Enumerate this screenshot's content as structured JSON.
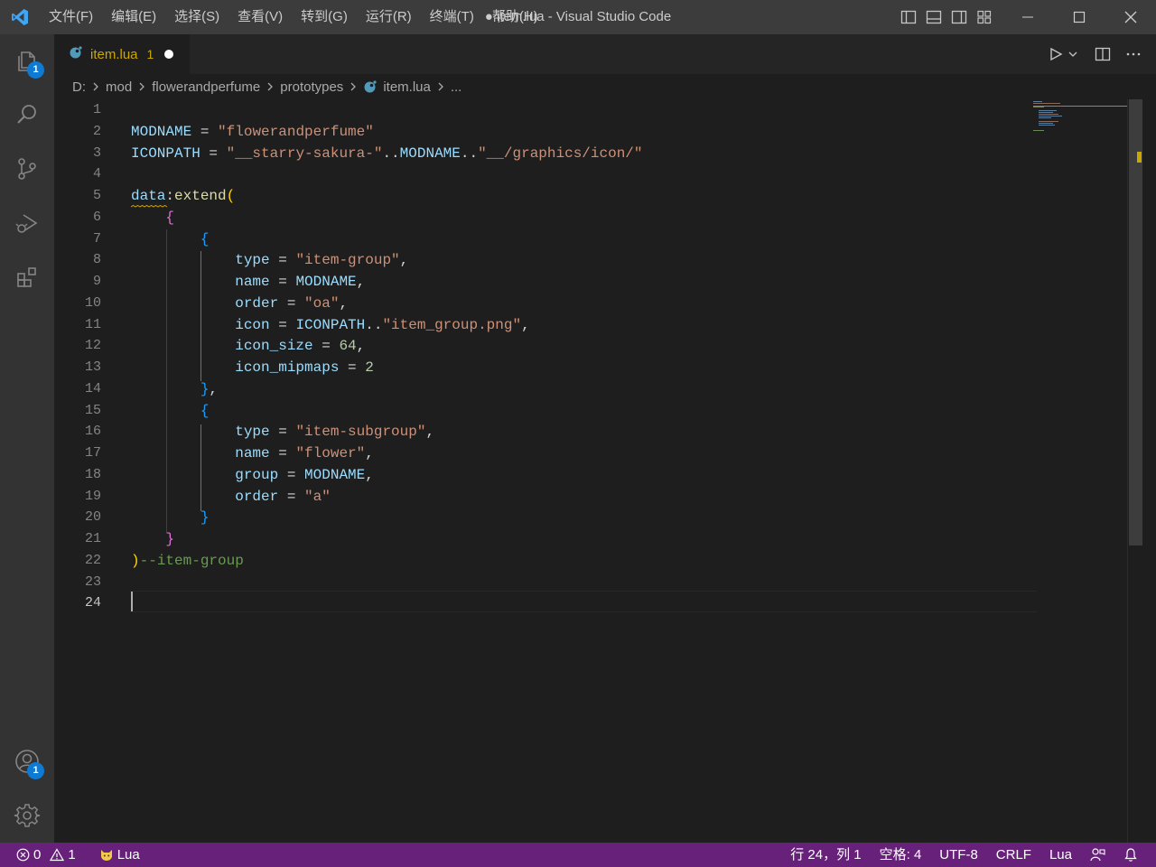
{
  "window": {
    "title": "● item.lua - Visual Studio Code",
    "menu": [
      "文件(F)",
      "编辑(E)",
      "选择(S)",
      "查看(V)",
      "转到(G)",
      "运行(R)",
      "终端(T)",
      "帮助(H)"
    ]
  },
  "activity_bar": {
    "explorer_badge": "1",
    "accounts_badge": "1"
  },
  "tab": {
    "name": "item.lua",
    "problem_count": "1"
  },
  "breadcrumb": [
    "D:",
    "mod",
    "flowerandperfume",
    "prototypes",
    "item.lua",
    "..."
  ],
  "editor": {
    "line_numbers": [
      "1",
      "2",
      "3",
      "4",
      "5",
      "6",
      "7",
      "8",
      "9",
      "10",
      "11",
      "12",
      "13",
      "14",
      "15",
      "16",
      "17",
      "18",
      "19",
      "20",
      "21",
      "22",
      "23",
      "24"
    ],
    "active_line": "24",
    "lines": [
      [],
      [
        {
          "t": "MODNAME",
          "c": "v-var"
        },
        {
          "t": " = ",
          "c": "v-op"
        },
        {
          "t": "\"flowerandperfume\"",
          "c": "v-str"
        }
      ],
      [
        {
          "t": "ICONPATH",
          "c": "v-var"
        },
        {
          "t": " = ",
          "c": "v-op"
        },
        {
          "t": "\"__starry-sakura-\"",
          "c": "v-str"
        },
        {
          "t": "..",
          "c": "v-op"
        },
        {
          "t": "MODNAME",
          "c": "v-var"
        },
        {
          "t": "..",
          "c": "v-op"
        },
        {
          "t": "\"__/graphics/icon/\"",
          "c": "v-str"
        }
      ],
      [],
      [
        {
          "t": "data",
          "c": "v-var"
        },
        {
          "t": ":",
          "c": "v-op"
        },
        {
          "t": "extend",
          "c": "v-fn"
        },
        {
          "t": "(",
          "c": "v-b1"
        }
      ],
      [
        {
          "t": "    ",
          "c": "v-op"
        },
        {
          "t": "{",
          "c": "v-b2"
        }
      ],
      [
        {
          "t": "        ",
          "c": "v-op"
        },
        {
          "t": "{",
          "c": "v-b3"
        }
      ],
      [
        {
          "t": "            ",
          "c": "v-op"
        },
        {
          "t": "type",
          "c": "v-var"
        },
        {
          "t": " = ",
          "c": "v-op"
        },
        {
          "t": "\"item-group\"",
          "c": "v-str"
        },
        {
          "t": ",",
          "c": "v-op"
        }
      ],
      [
        {
          "t": "            ",
          "c": "v-op"
        },
        {
          "t": "name",
          "c": "v-var"
        },
        {
          "t": " = ",
          "c": "v-op"
        },
        {
          "t": "MODNAME",
          "c": "v-var"
        },
        {
          "t": ",",
          "c": "v-op"
        }
      ],
      [
        {
          "t": "            ",
          "c": "v-op"
        },
        {
          "t": "order",
          "c": "v-var"
        },
        {
          "t": " = ",
          "c": "v-op"
        },
        {
          "t": "\"oa\"",
          "c": "v-str"
        },
        {
          "t": ",",
          "c": "v-op"
        }
      ],
      [
        {
          "t": "            ",
          "c": "v-op"
        },
        {
          "t": "icon",
          "c": "v-var"
        },
        {
          "t": " = ",
          "c": "v-op"
        },
        {
          "t": "ICONPATH",
          "c": "v-var"
        },
        {
          "t": "..",
          "c": "v-op"
        },
        {
          "t": "\"item_group.png\"",
          "c": "v-str"
        },
        {
          "t": ",",
          "c": "v-op"
        }
      ],
      [
        {
          "t": "            ",
          "c": "v-op"
        },
        {
          "t": "icon_size",
          "c": "v-var"
        },
        {
          "t": " = ",
          "c": "v-op"
        },
        {
          "t": "64",
          "c": "v-num"
        },
        {
          "t": ",",
          "c": "v-op"
        }
      ],
      [
        {
          "t": "            ",
          "c": "v-op"
        },
        {
          "t": "icon_mipmaps",
          "c": "v-var"
        },
        {
          "t": " = ",
          "c": "v-op"
        },
        {
          "t": "2",
          "c": "v-num"
        }
      ],
      [
        {
          "t": "        ",
          "c": "v-op"
        },
        {
          "t": "}",
          "c": "v-b3"
        },
        {
          "t": ",",
          "c": "v-op"
        }
      ],
      [
        {
          "t": "        ",
          "c": "v-op"
        },
        {
          "t": "{",
          "c": "v-b3"
        }
      ],
      [
        {
          "t": "            ",
          "c": "v-op"
        },
        {
          "t": "type",
          "c": "v-var"
        },
        {
          "t": " = ",
          "c": "v-op"
        },
        {
          "t": "\"item-subgroup\"",
          "c": "v-str"
        },
        {
          "t": ",",
          "c": "v-op"
        }
      ],
      [
        {
          "t": "            ",
          "c": "v-op"
        },
        {
          "t": "name",
          "c": "v-var"
        },
        {
          "t": " = ",
          "c": "v-op"
        },
        {
          "t": "\"flower\"",
          "c": "v-str"
        },
        {
          "t": ",",
          "c": "v-op"
        }
      ],
      [
        {
          "t": "            ",
          "c": "v-op"
        },
        {
          "t": "group",
          "c": "v-var"
        },
        {
          "t": " = ",
          "c": "v-op"
        },
        {
          "t": "MODNAME",
          "c": "v-var"
        },
        {
          "t": ",",
          "c": "v-op"
        }
      ],
      [
        {
          "t": "            ",
          "c": "v-op"
        },
        {
          "t": "order",
          "c": "v-var"
        },
        {
          "t": " = ",
          "c": "v-op"
        },
        {
          "t": "\"a\"",
          "c": "v-str"
        }
      ],
      [
        {
          "t": "        ",
          "c": "v-op"
        },
        {
          "t": "}",
          "c": "v-b3"
        }
      ],
      [
        {
          "t": "    ",
          "c": "v-op"
        },
        {
          "t": "}",
          "c": "v-b2"
        }
      ],
      [
        {
          "t": ")",
          "c": "v-b1"
        },
        {
          "t": "--item-group",
          "c": "v-cmt"
        }
      ],
      [],
      []
    ]
  },
  "status_bar": {
    "errors": "0",
    "warnings": "1",
    "language_server": "Lua",
    "position": "行 24，列 1",
    "indent": "空格: 4",
    "encoding": "UTF-8",
    "eol": "CRLF",
    "language": "Lua"
  },
  "colors": {
    "statusbar": "#68217a",
    "activitybar": "#333333",
    "editor_bg": "#1e1e1e",
    "accent": "#0e7ad3",
    "warning": "#cca700"
  }
}
